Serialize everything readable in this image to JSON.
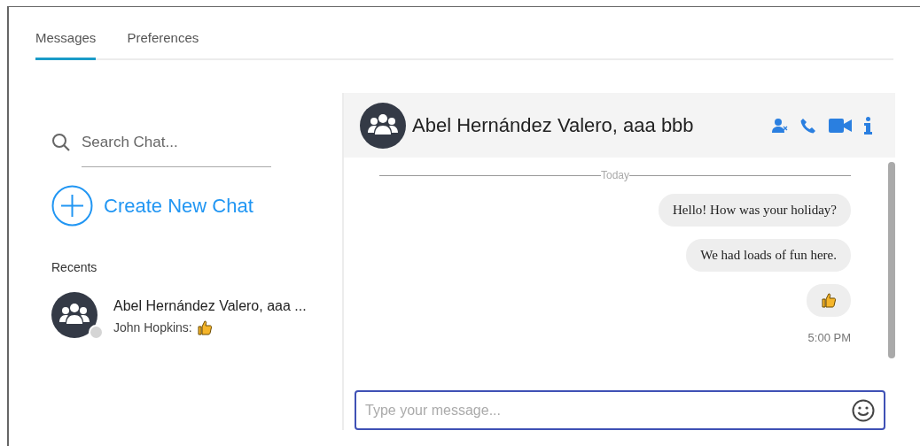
{
  "tabs": [
    {
      "label": "Messages",
      "selected": true
    },
    {
      "label": "Preferences",
      "selected": false
    }
  ],
  "sidebar": {
    "search": {
      "placeholder": "Search Chat..."
    },
    "create_button": "Create New Chat",
    "recents_heading": "Recents",
    "recents": [
      {
        "name": "Abel Hernández Valero, aaa ...",
        "preview": "John Hopkins:",
        "online": false,
        "selected": false
      }
    ]
  },
  "chat": {
    "title": "Abel Hernández Valero, aaa bbb",
    "divider": "Today",
    "messages": [
      {
        "kind": "text",
        "text": "Hello! How was your holiday?"
      },
      {
        "kind": "text",
        "text": "We had loads of fun here."
      },
      {
        "kind": "thumbs-up"
      }
    ],
    "time": "5:00 PM",
    "composer": {
      "placeholder": "Type your message..."
    }
  }
}
